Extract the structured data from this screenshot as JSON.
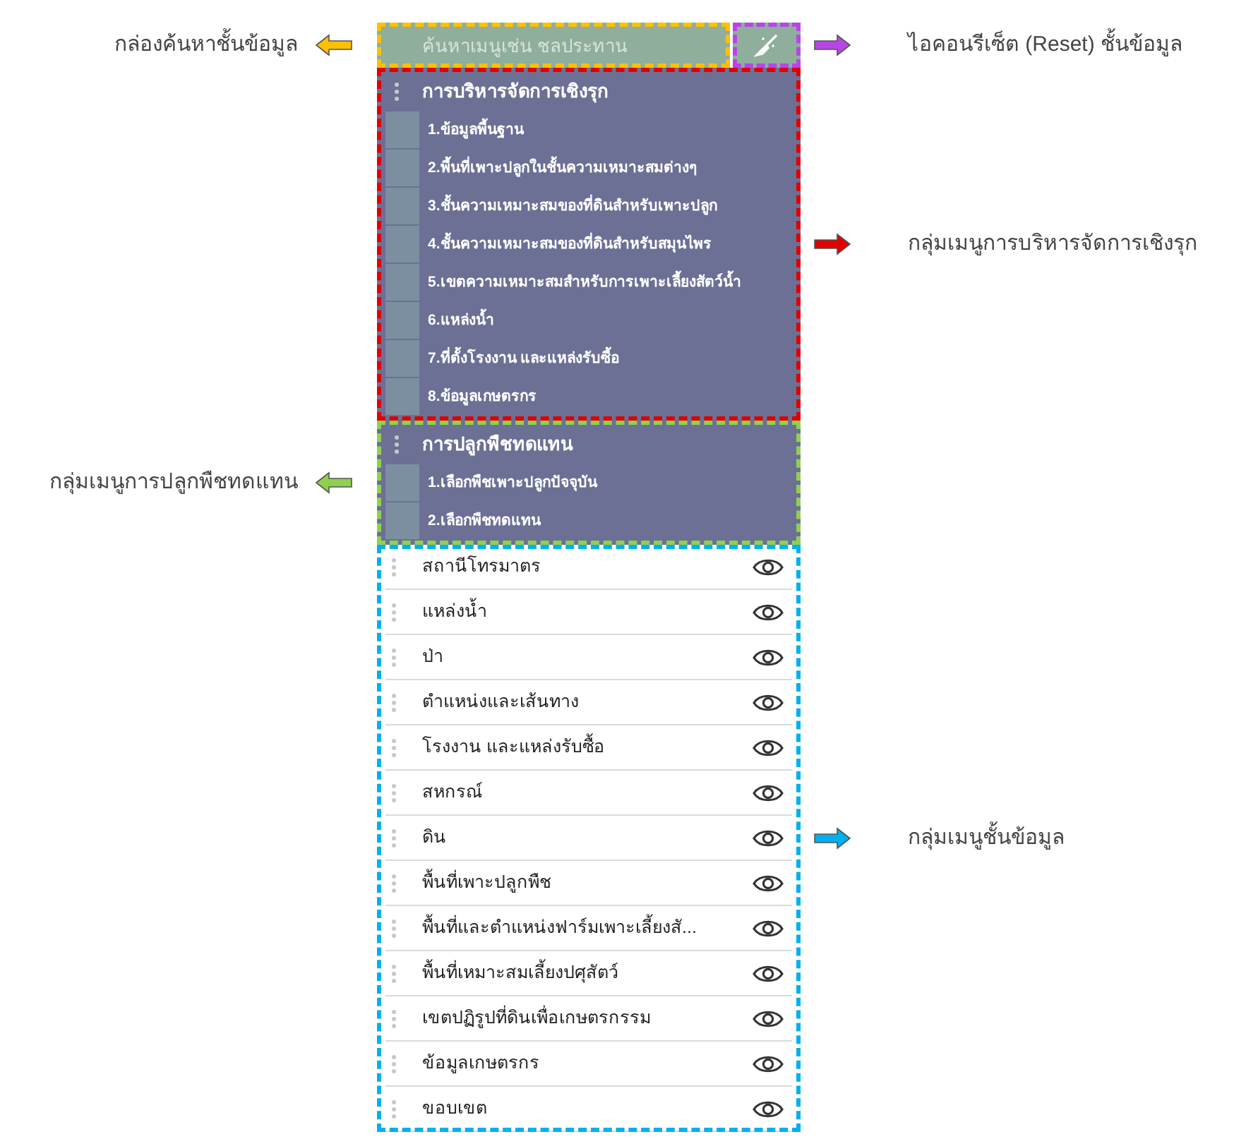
{
  "search": {
    "placeholder": "ค้นหาเมนูเช่น ชลประทาน",
    "callout": {
      "kind": "left",
      "text": "กล่องค้นหาชั้นข้อมูล",
      "color": "#ffc000"
    }
  },
  "reset_button": {
    "callout": {
      "kind": "right",
      "text": "ไอคอนรีเซ็ต (Reset) ชั้นข้อมูล",
      "color": "#b845e6"
    }
  },
  "menu_groups": [
    {
      "title": "การบริหารจัดการเชิงรุก",
      "callout": {
        "kind": "right",
        "text": "กลุ่มเมนูการบริหารจัดการเชิงรุก",
        "color": "#e00000"
      },
      "items": [
        "1.ข้อมูลพื้นฐาน",
        "2.พื้นที่เพาะปลูกในชั้นความเหมาะสมต่างๆ",
        "3.ชั้นความเหมาะสมของที่ดินสำหรับเพาะปลูก",
        "4.ชั้นความเหมาะสมของที่ดินสำหรับสมุนไพร",
        "5.เขตความเหมาะสมสำหรับการเพาะเลี้ยงสัตว์น้ำ",
        "6.แหล่งน้ำ",
        "7.ที่ตั้งโรงงาน และแหล่งรับซื้อ",
        "8.ข้อมูลเกษตรกร"
      ]
    },
    {
      "title": "การปลูกพืชทดแทน",
      "callout": {
        "kind": "left",
        "text": "กลุ่มเมนูการปลูกพืชทดแทน",
        "color": "#8fd14f"
      },
      "items": [
        "1.เลือกพืชเพาะปลูกปัจจุบัน",
        "2.เลือกพืชทดแทน"
      ]
    }
  ],
  "layers": {
    "callout": {
      "kind": "right",
      "text": "กลุ่มเมนูชั้นข้อมูล",
      "color": "#00b0f0"
    },
    "items": [
      "สถานีโทรมาตร",
      "แหล่งน้ำ",
      "ป่า",
      "ตำแหน่งและเส้นทาง",
      "โรงงาน และแหล่งรับซื้อ",
      "สหกรณ์",
      "ดิน",
      "พื้นที่เพาะปลูกพืช",
      "พื้นที่และตำแหน่งฟาร์มเพาะเลี้ยงสั...",
      "พื้นที่เหมาะสมเลี้ยงปศุสัตว์",
      "เขตปฏิรูปที่ดินเพื่อเกษตรกรรม",
      "ข้อมูลเกษตรกร",
      "ขอบเขต"
    ]
  }
}
